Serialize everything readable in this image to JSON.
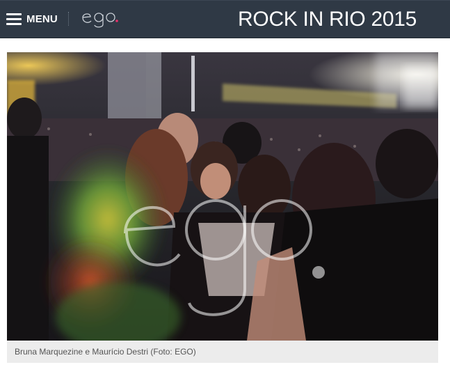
{
  "header": {
    "menu_label": "MENU",
    "logo_text": "ego",
    "title": "ROCK IN RIO 2015"
  },
  "photo": {
    "watermark": "ego."
  },
  "caption": {
    "text": "Bruna Marquezine e Maurício Destri (Foto: EGO)"
  },
  "colors": {
    "header_bg": "#2f3945",
    "logo_dot": "#e8306a",
    "caption_bg": "#ececec"
  },
  "icons": {
    "menu": "hamburger-icon"
  }
}
